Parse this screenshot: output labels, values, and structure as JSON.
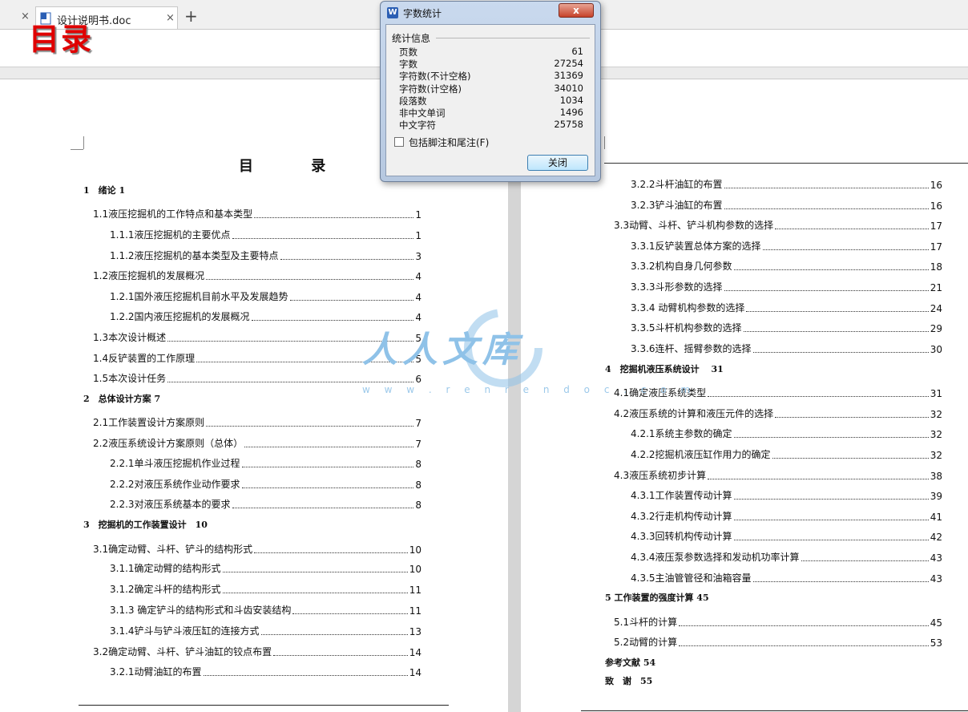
{
  "tabbar": {
    "close_left": "×",
    "tab_title": "设计说明书.doc",
    "tab_close": "×",
    "new_tab": "+"
  },
  "overlay_word": "目录",
  "doc": {
    "toc_title": "目 录",
    "left_entries": [
      {
        "kind": "head",
        "text": "1　绪论 1"
      },
      {
        "kind": "entry",
        "text": "1.1液压挖掘机的工作特点和基本类型",
        "page": "1"
      },
      {
        "kind": "entry",
        "text": "1.1.1液压挖掘机的主要优点",
        "page": "1"
      },
      {
        "kind": "entry",
        "text": "1.1.2液压挖掘机的基本类型及主要特点",
        "page": "3"
      },
      {
        "kind": "entry",
        "text": "1.2液压挖掘机的发展概况",
        "page": "4"
      },
      {
        "kind": "entry",
        "text": "1.2.1国外液压挖掘机目前水平及发展趋势",
        "page": "4"
      },
      {
        "kind": "entry",
        "text": "1.2.2国内液压挖掘机的发展概况",
        "page": "4"
      },
      {
        "kind": "entry",
        "text": "1.3本次设计概述",
        "page": "5"
      },
      {
        "kind": "entry",
        "text": "1.4反铲装置的工作原理",
        "page": "5"
      },
      {
        "kind": "entry",
        "text": "1.5本次设计任务",
        "page": "6"
      },
      {
        "kind": "head",
        "text": "2　总体设计方案 7"
      },
      {
        "kind": "entry",
        "text": "2.1工作装置设计方案原则",
        "page": "7"
      },
      {
        "kind": "entry",
        "text": "2.2液压系统设计方案原则（总体）",
        "page": "7"
      },
      {
        "kind": "entry",
        "text": "2.2.1单斗液压挖掘机作业过程",
        "page": "8"
      },
      {
        "kind": "entry",
        "text": "2.2.2对液压系统作业动作要求",
        "page": "8"
      },
      {
        "kind": "entry",
        "text": "2.2.3对液压系统基本的要求",
        "page": "8"
      },
      {
        "kind": "head",
        "text": "3　挖掘机的工作装置设计　10"
      },
      {
        "kind": "entry",
        "text": "3.1确定动臂、斗杆、铲斗的结构形式",
        "page": "10"
      },
      {
        "kind": "entry",
        "text": "3.1.1确定动臂的结构形式",
        "page": "10"
      },
      {
        "kind": "entry",
        "text": "3.1.2确定斗杆的结构形式",
        "page": "11"
      },
      {
        "kind": "entry",
        "text": "3.1.3 确定铲斗的结构形式和斗齿安装结构",
        "page": "11"
      },
      {
        "kind": "entry",
        "text": "3.1.4铲斗与铲斗液压缸的连接方式",
        "page": "13"
      },
      {
        "kind": "entry",
        "text": "3.2确定动臂、斗杆、铲斗油缸的铰点布置",
        "page": "14"
      },
      {
        "kind": "entry",
        "text": "3.2.1动臂油缸的布置",
        "page": "14"
      }
    ],
    "right_entries": [
      {
        "kind": "entry",
        "text": "3.2.2斗杆油缸的布置",
        "page": "16"
      },
      {
        "kind": "entry",
        "text": "3.2.3铲斗油缸的布置",
        "page": "16"
      },
      {
        "kind": "entry",
        "text": "3.3动臂、斗杆、铲斗机构参数的选择",
        "page": "17"
      },
      {
        "kind": "entry",
        "text": "3.3.1反铲装置总体方案的选择",
        "page": "17"
      },
      {
        "kind": "entry",
        "text": "3.3.2机构自身几何参数",
        "page": "18"
      },
      {
        "kind": "entry",
        "text": "3.3.3斗形参数的选择",
        "page": "21"
      },
      {
        "kind": "entry",
        "text": "3.3.4 动臂机构参数的选择",
        "page": "24"
      },
      {
        "kind": "entry",
        "text": "3.3.5斗杆机构参数的选择",
        "page": "29"
      },
      {
        "kind": "entry",
        "text": "3.3.6连杆、摇臂参数的选择",
        "page": "30"
      },
      {
        "kind": "head",
        "text": "4　挖掘机液压系统设计　 31"
      },
      {
        "kind": "entry",
        "text": "4.1确定液压系统类型",
        "page": "31"
      },
      {
        "kind": "entry",
        "text": "4.2液压系统的计算和液压元件的选择",
        "page": "32"
      },
      {
        "kind": "entry",
        "text": "4.2.1系统主参数的确定",
        "page": "32"
      },
      {
        "kind": "entry",
        "text": "4.2.2挖掘机液压缸作用力的确定",
        "page": "32"
      },
      {
        "kind": "entry",
        "text": "4.3液压系统初步计算",
        "page": "38"
      },
      {
        "kind": "entry",
        "text": "4.3.1工作装置传动计算",
        "page": "39"
      },
      {
        "kind": "entry",
        "text": "4.3.2行走机构传动计算",
        "page": "41"
      },
      {
        "kind": "entry",
        "text": "4.3.3回转机构传动计算",
        "page": "42"
      },
      {
        "kind": "entry",
        "text": "4.3.4液压泵参数选择和发动机功率计算",
        "page": "43"
      },
      {
        "kind": "entry",
        "text": "4.3.5主油管管径和油箱容量",
        "page": "43"
      },
      {
        "kind": "head",
        "text": "5 工作装置的强度计算 45"
      },
      {
        "kind": "entry",
        "text": "5.1斗杆的计算",
        "page": "45"
      },
      {
        "kind": "entry",
        "text": "5.2动臂的计算",
        "page": "53"
      },
      {
        "kind": "head",
        "text": "参考文献 54"
      },
      {
        "kind": "head",
        "text": "致　谢　55"
      }
    ]
  },
  "watermark": {
    "text": "人人文库",
    "url": "w w w . r e n r e n d o c . c o m"
  },
  "dialog": {
    "icon_letter": "W",
    "title": "字数统计",
    "close_glyph": "x",
    "group_label": "统计信息",
    "stats": [
      {
        "label": "页数",
        "value": "61"
      },
      {
        "label": "字数",
        "value": "27254"
      },
      {
        "label": "字符数(不计空格)",
        "value": "31369"
      },
      {
        "label": "字符数(计空格)",
        "value": "34010"
      },
      {
        "label": "段落数",
        "value": "1034"
      },
      {
        "label": "非中文单词",
        "value": "1496"
      },
      {
        "label": "中文字符",
        "value": "25758"
      }
    ],
    "checkbox_label": "包括脚注和尾注(F)",
    "checkbox_checked": false,
    "close_button": "关闭"
  }
}
